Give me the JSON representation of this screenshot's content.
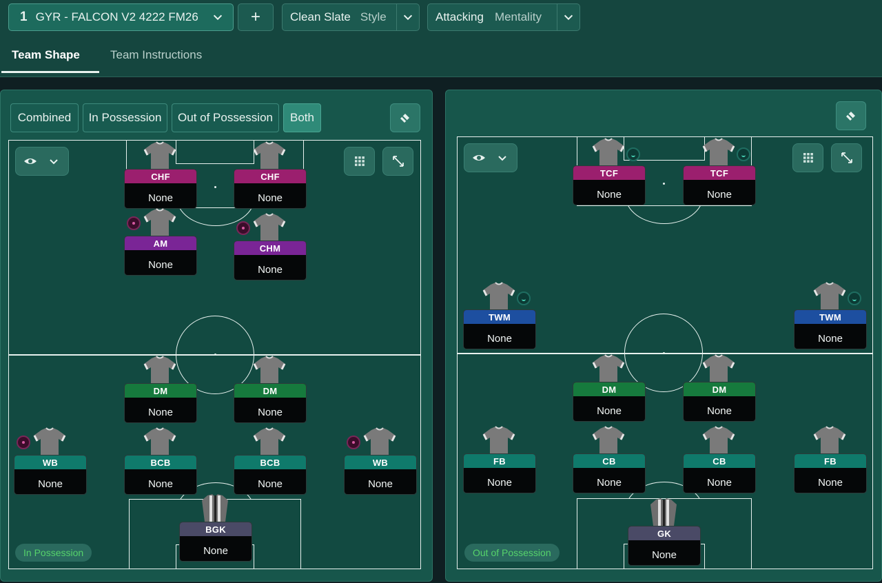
{
  "topbar": {
    "tactic_slot": "1",
    "tactic_name": "GYR - FALCON V2 4222 FM26",
    "add_label": "+",
    "style_value": "Clean Slate",
    "style_label": "Style",
    "mentality_value": "Attacking",
    "mentality_label": "Mentality"
  },
  "tabs": {
    "team_shape": "Team Shape",
    "team_instructions": "Team Instructions"
  },
  "left_panel": {
    "segments": [
      "Combined",
      "In Possession",
      "Out of Possession",
      "Both"
    ],
    "active_segment": "Both",
    "phase_tag": "In Possession",
    "players": [
      {
        "role": "CHF",
        "name": "None",
        "color": "#9b1f6e"
      },
      {
        "role": "CHF",
        "name": "None",
        "color": "#9b1f6e"
      },
      {
        "role": "AM",
        "name": "None",
        "color": "#7a2596"
      },
      {
        "role": "CHM",
        "name": "None",
        "color": "#7a2596"
      },
      {
        "role": "DM",
        "name": "None",
        "color": "#167a3d"
      },
      {
        "role": "DM",
        "name": "None",
        "color": "#167a3d"
      },
      {
        "role": "WB",
        "name": "None",
        "color": "#0f7a6b"
      },
      {
        "role": "BCB",
        "name": "None",
        "color": "#0f7a6b"
      },
      {
        "role": "BCB",
        "name": "None",
        "color": "#0f7a6b"
      },
      {
        "role": "WB",
        "name": "None",
        "color": "#0f7a6b"
      },
      {
        "role": "BGK",
        "name": "None",
        "color": "#4a4a66"
      }
    ]
  },
  "right_panel": {
    "phase_tag": "Out of Possession",
    "players": [
      {
        "role": "TCF",
        "name": "None",
        "color": "#9b1f6e"
      },
      {
        "role": "TCF",
        "name": "None",
        "color": "#9b1f6e"
      },
      {
        "role": "TWM",
        "name": "None",
        "color": "#1d4fa0"
      },
      {
        "role": "TWM",
        "name": "None",
        "color": "#1d4fa0"
      },
      {
        "role": "DM",
        "name": "None",
        "color": "#167a3d"
      },
      {
        "role": "DM",
        "name": "None",
        "color": "#167a3d"
      },
      {
        "role": "FB",
        "name": "None",
        "color": "#0f7a6b"
      },
      {
        "role": "CB",
        "name": "None",
        "color": "#0f7a6b"
      },
      {
        "role": "CB",
        "name": "None",
        "color": "#0f7a6b"
      },
      {
        "role": "FB",
        "name": "None",
        "color": "#0f7a6b"
      },
      {
        "role": "GK",
        "name": "None",
        "color": "#4a4a66"
      }
    ]
  },
  "icons": {
    "dropdown": "chevron-down-icon",
    "visibility": "eye-icon",
    "grid": "grid-icon",
    "expand": "expand-icon",
    "eraser": "eraser-icon",
    "shirt": "shirt-icon"
  }
}
